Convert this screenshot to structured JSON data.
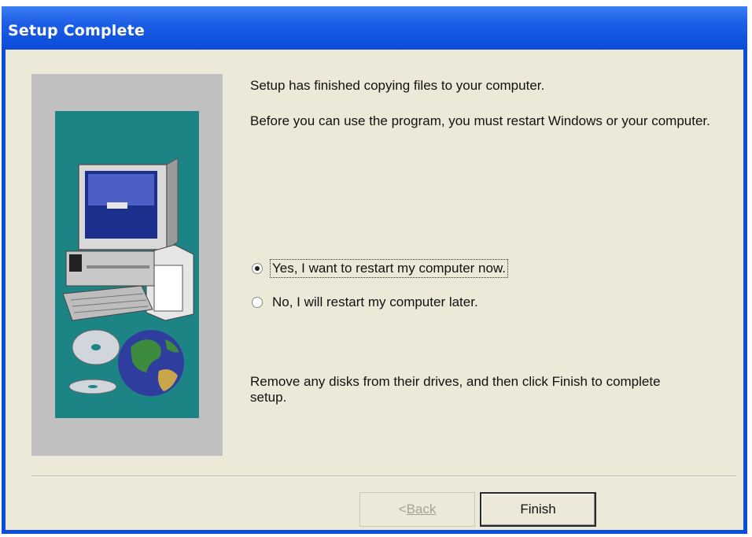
{
  "window": {
    "title": "Setup Complete"
  },
  "content": {
    "line1": "Setup has finished copying files to your computer.",
    "line2": "Before you can use the program, you must restart Windows or your computer.",
    "options": [
      {
        "label": "Yes, I want to restart my computer now.",
        "selected": true
      },
      {
        "label": "No, I will restart my computer later.",
        "selected": false
      }
    ],
    "instruction": "Remove any disks from their drives, and then click Finish to complete setup."
  },
  "buttons": {
    "back_prefix": "< ",
    "back_label": "Back",
    "finish_label": "Finish"
  },
  "colors": {
    "titlebar": "#0a4ddc",
    "dialog_bg": "#ece9d8",
    "graphic_bg": "#1c8484",
    "graphic_frame": "#c0c0c0"
  },
  "icons": {
    "graphic": "computer-globe-cd-illustration"
  }
}
